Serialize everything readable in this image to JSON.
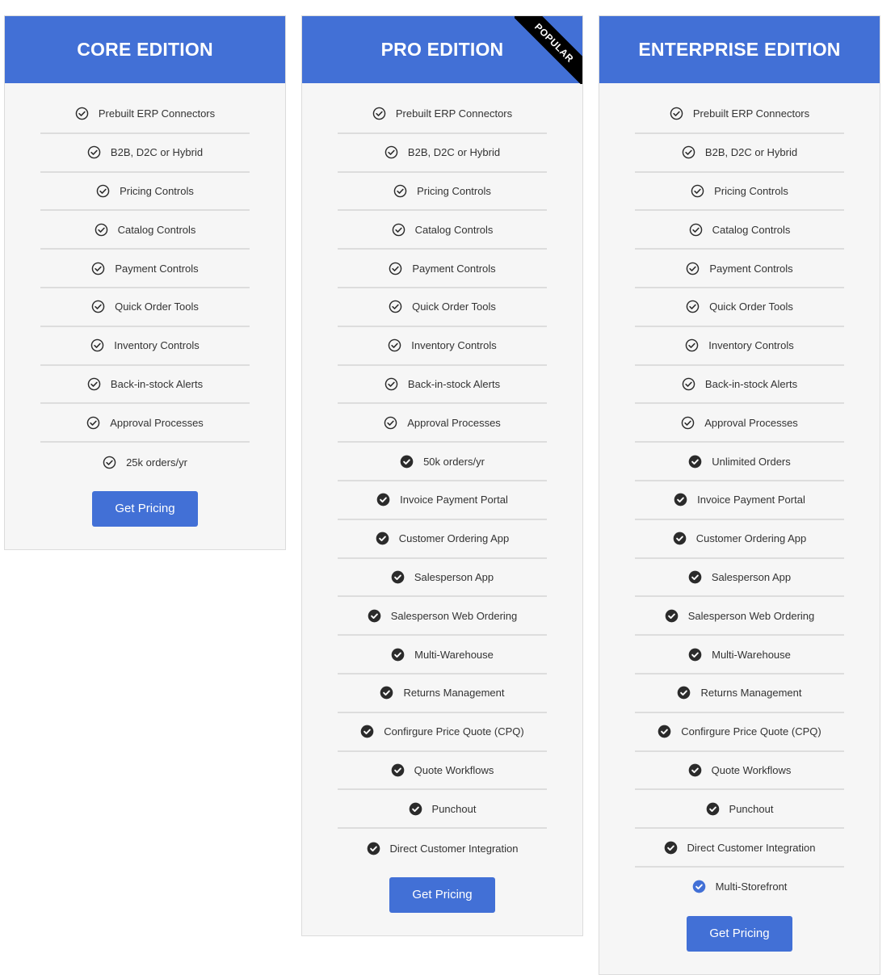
{
  "colors": {
    "accent": "#4270d6",
    "card_bg": "#f6f6f6",
    "check_dark": "#2b2b2b"
  },
  "plans": [
    {
      "title": "CORE EDITION",
      "badge": null,
      "features": [
        {
          "label": "Prebuilt ERP Connectors",
          "icon": "check-circle-outline-icon"
        },
        {
          "label": "B2B, D2C or Hybrid",
          "icon": "check-circle-outline-icon"
        },
        {
          "label": "Pricing Controls",
          "icon": "check-circle-outline-icon"
        },
        {
          "label": "Catalog Controls",
          "icon": "check-circle-outline-icon"
        },
        {
          "label": "Payment Controls",
          "icon": "check-circle-outline-icon"
        },
        {
          "label": "Quick Order Tools",
          "icon": "check-circle-outline-icon"
        },
        {
          "label": "Inventory Controls",
          "icon": "check-circle-outline-icon"
        },
        {
          "label": "Back-in-stock Alerts",
          "icon": "check-circle-outline-icon"
        },
        {
          "label": "Approval Processes",
          "icon": "check-circle-outline-icon"
        },
        {
          "label": "25k orders/yr",
          "icon": "check-circle-outline-icon"
        }
      ],
      "button": "Get Pricing"
    },
    {
      "title": "PRO EDITION",
      "badge": "POPULAR",
      "features": [
        {
          "label": "Prebuilt ERP Connectors",
          "icon": "check-circle-outline-icon"
        },
        {
          "label": "B2B, D2C or Hybrid",
          "icon": "check-circle-outline-icon"
        },
        {
          "label": "Pricing Controls",
          "icon": "check-circle-outline-icon"
        },
        {
          "label": "Catalog Controls",
          "icon": "check-circle-outline-icon"
        },
        {
          "label": "Payment Controls",
          "icon": "check-circle-outline-icon"
        },
        {
          "label": "Quick Order Tools",
          "icon": "check-circle-outline-icon"
        },
        {
          "label": "Inventory Controls",
          "icon": "check-circle-outline-icon"
        },
        {
          "label": "Back-in-stock Alerts",
          "icon": "check-circle-outline-icon"
        },
        {
          "label": "Approval Processes",
          "icon": "check-circle-outline-icon"
        },
        {
          "label": "50k orders/yr",
          "icon": "check-circle-filled-icon"
        },
        {
          "label": "Invoice Payment Portal",
          "icon": "check-circle-filled-icon"
        },
        {
          "label": "Customer Ordering App",
          "icon": "check-circle-filled-icon"
        },
        {
          "label": "Salesperson App",
          "icon": "check-circle-filled-icon"
        },
        {
          "label": "Salesperson Web Ordering",
          "icon": "check-circle-filled-icon"
        },
        {
          "label": "Multi-Warehouse",
          "icon": "check-circle-filled-icon"
        },
        {
          "label": "Returns Management",
          "icon": "check-circle-filled-icon"
        },
        {
          "label": "Confirgure Price Quote (CPQ)",
          "icon": "check-circle-filled-icon"
        },
        {
          "label": "Quote Workflows",
          "icon": "check-circle-filled-icon"
        },
        {
          "label": "Punchout",
          "icon": "check-circle-filled-icon"
        },
        {
          "label": "Direct Customer Integration",
          "icon": "check-circle-filled-icon"
        }
      ],
      "button": "Get Pricing"
    },
    {
      "title": "ENTERPRISE EDITION",
      "badge": null,
      "features": [
        {
          "label": "Prebuilt ERP Connectors",
          "icon": "check-circle-outline-icon"
        },
        {
          "label": "B2B, D2C or Hybrid",
          "icon": "check-circle-outline-icon"
        },
        {
          "label": "Pricing Controls",
          "icon": "check-circle-outline-icon"
        },
        {
          "label": "Catalog Controls",
          "icon": "check-circle-outline-icon"
        },
        {
          "label": "Payment Controls",
          "icon": "check-circle-outline-icon"
        },
        {
          "label": "Quick Order Tools",
          "icon": "check-circle-outline-icon"
        },
        {
          "label": "Inventory Controls",
          "icon": "check-circle-outline-icon"
        },
        {
          "label": "Back-in-stock Alerts",
          "icon": "check-circle-outline-icon"
        },
        {
          "label": "Approval Processes",
          "icon": "check-circle-outline-icon"
        },
        {
          "label": "Unlimited Orders",
          "icon": "check-circle-filled-icon"
        },
        {
          "label": "Invoice Payment Portal",
          "icon": "check-circle-filled-icon"
        },
        {
          "label": "Customer Ordering App",
          "icon": "check-circle-filled-icon"
        },
        {
          "label": "Salesperson App",
          "icon": "check-circle-filled-icon"
        },
        {
          "label": "Salesperson Web Ordering",
          "icon": "check-circle-filled-icon"
        },
        {
          "label": "Multi-Warehouse",
          "icon": "check-circle-filled-icon"
        },
        {
          "label": "Returns Management",
          "icon": "check-circle-filled-icon"
        },
        {
          "label": "Confirgure Price Quote (CPQ)",
          "icon": "check-circle-filled-icon"
        },
        {
          "label": "Quote Workflows",
          "icon": "check-circle-filled-icon"
        },
        {
          "label": "Punchout",
          "icon": "check-circle-filled-icon"
        },
        {
          "label": "Direct Customer Integration",
          "icon": "check-circle-filled-icon"
        },
        {
          "label": "Multi-Storefront",
          "icon": "check-circle-blue-icon"
        }
      ],
      "button": "Get Pricing"
    }
  ]
}
